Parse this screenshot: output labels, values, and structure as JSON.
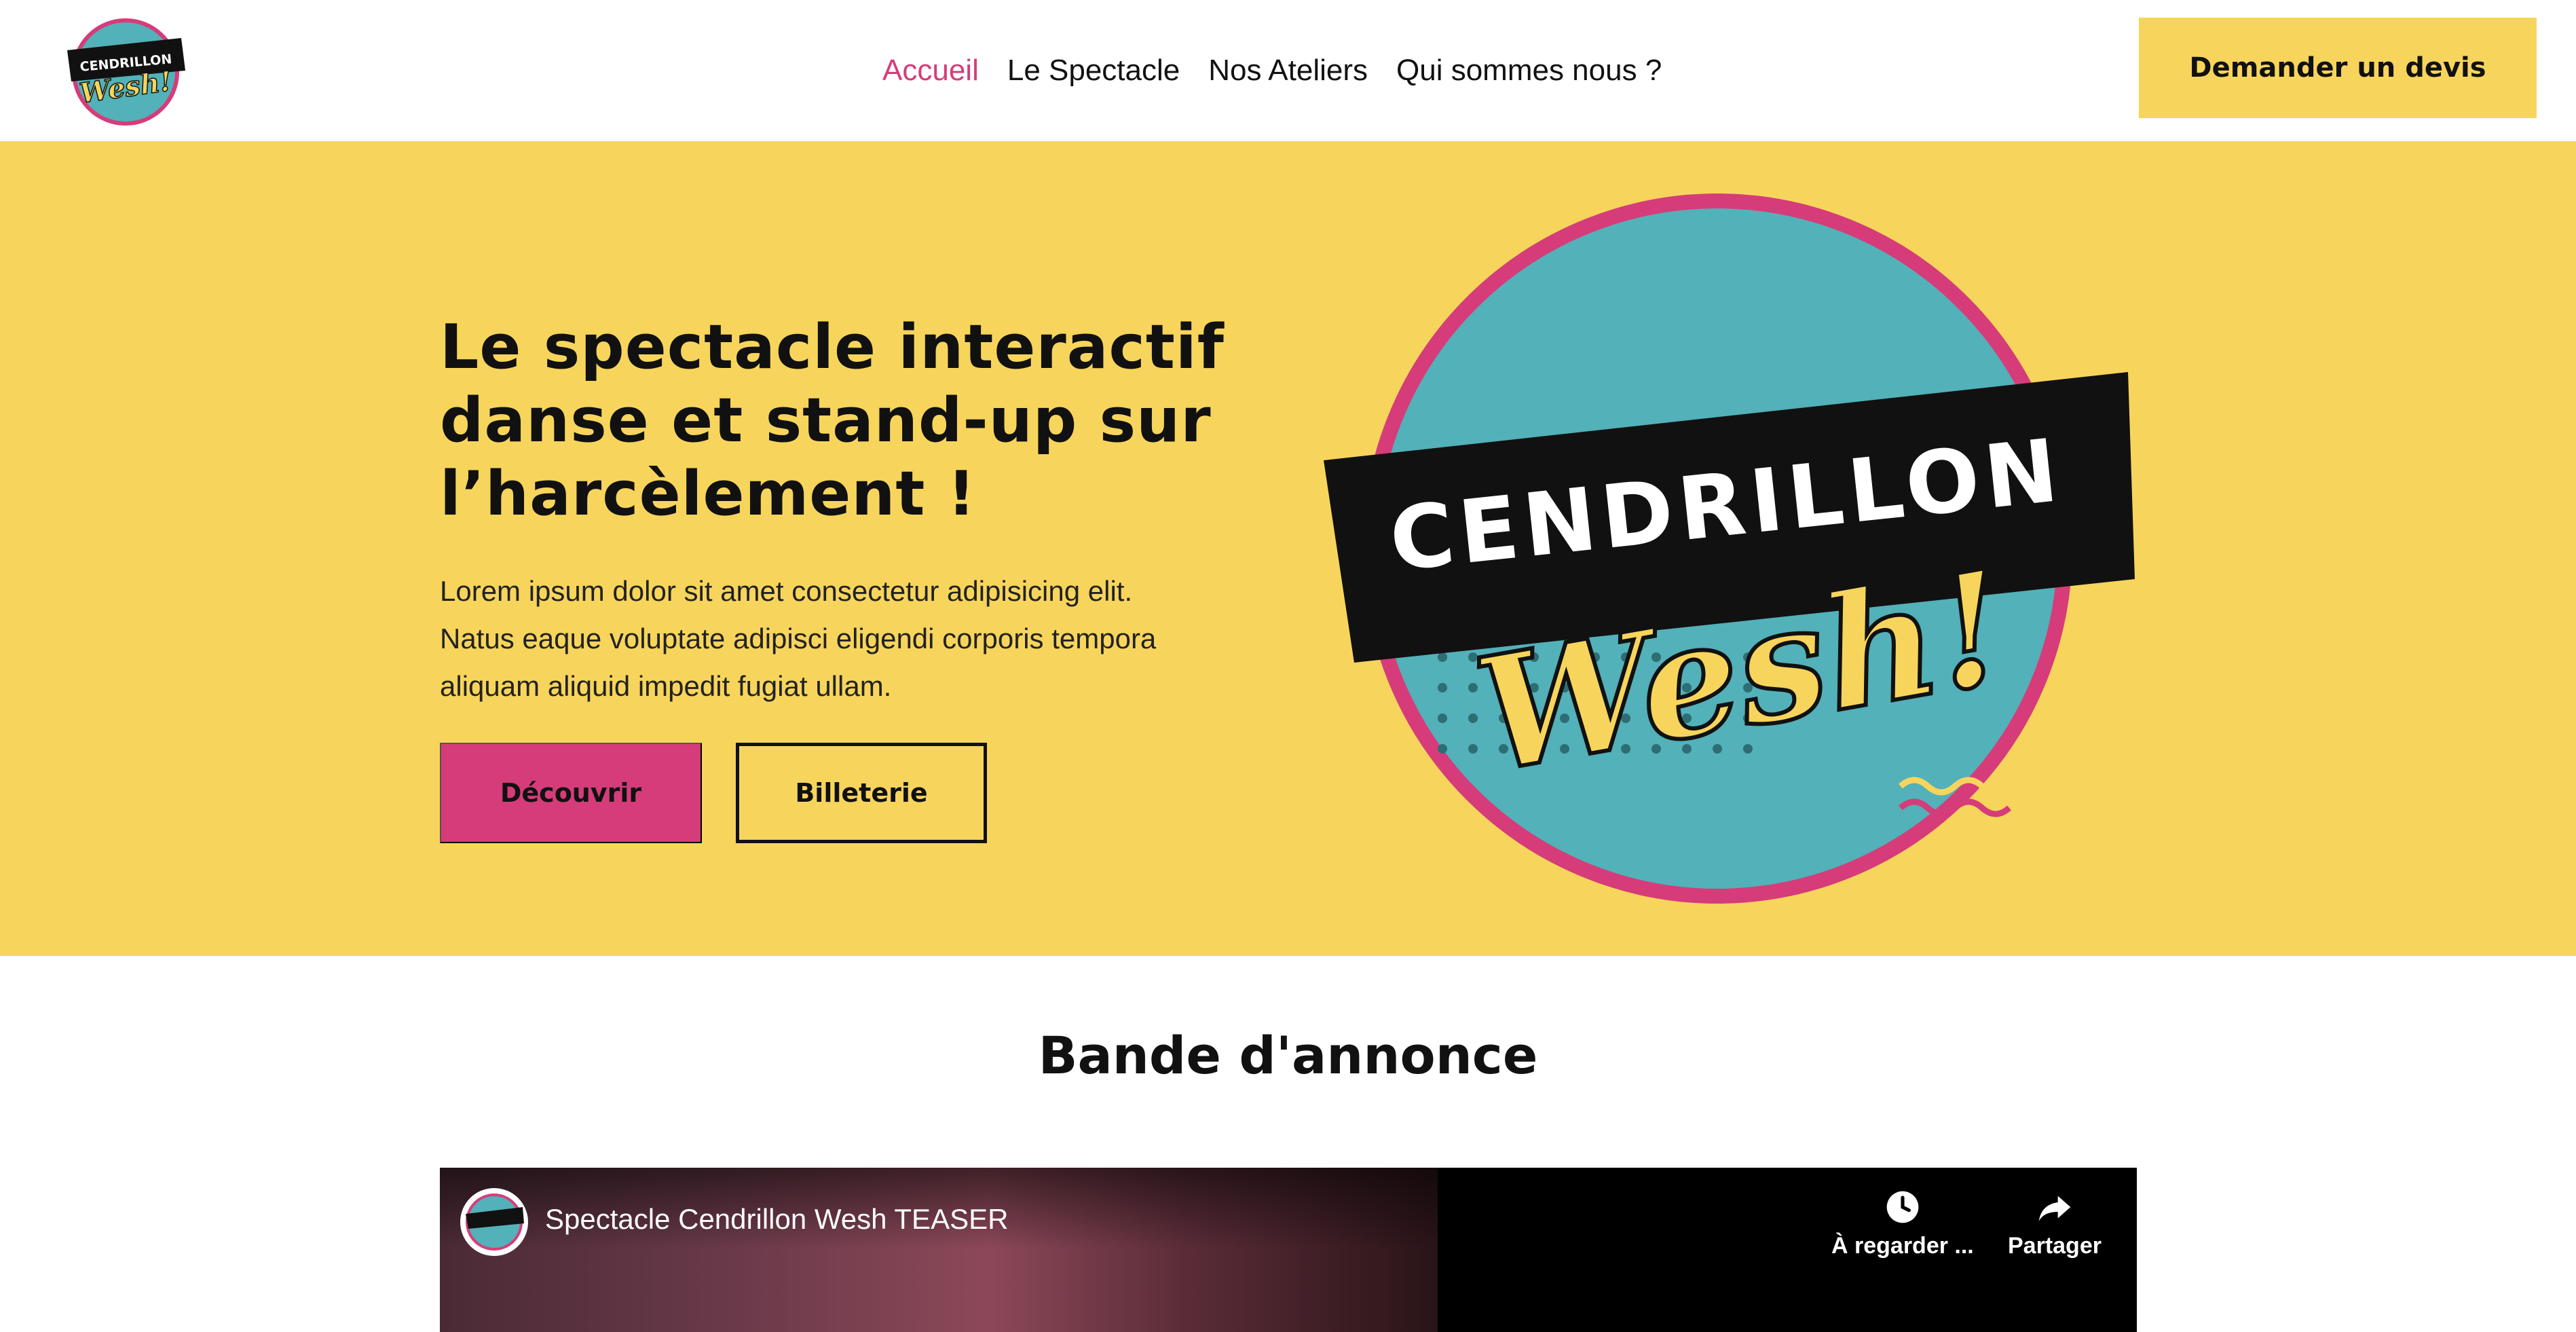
{
  "colors": {
    "accent_yellow": "#f7d55c",
    "accent_pink": "#d63c79",
    "teal": "#52b1b9",
    "ink": "#111111"
  },
  "logo": {
    "line1": "CENDRILLON",
    "line2": "Wesh!"
  },
  "nav": {
    "items": [
      {
        "label": "Accueil",
        "active": true
      },
      {
        "label": "Le Spectacle",
        "active": false
      },
      {
        "label": "Nos Ateliers",
        "active": false
      },
      {
        "label": "Qui sommes nous ?",
        "active": false
      }
    ],
    "cta_label": "Demander un devis"
  },
  "hero": {
    "title_lines": [
      "Le spectacle interactif",
      "danse et stand-up sur",
      "l’harcèlement !"
    ],
    "text_lines": [
      "Lorem ipsum dolor sit amet consectetur adipisicing elit.",
      "Natus eaque voluptate adipisci eligendi corporis tempora",
      "aliquam aliquid impedit fugiat ullam."
    ],
    "primary_button": "Découvrir",
    "secondary_button": "Billeterie"
  },
  "trailer": {
    "section_title": "Bande d'annonce",
    "video_title": "Spectacle Cendrillon Wesh TEASER",
    "watch_later_label": "À regarder ...",
    "share_label": "Partager",
    "watch_icon": "clock-icon",
    "share_icon": "share-arrow-icon"
  }
}
